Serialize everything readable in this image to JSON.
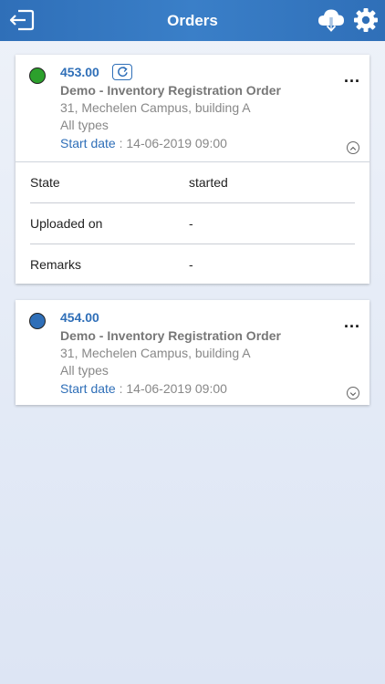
{
  "header": {
    "title": "Orders",
    "back_icon": "logout-arrow-icon",
    "download_icon": "cloud-download-icon",
    "settings_icon": "gear-icon",
    "color": "#2f6fb8"
  },
  "orders": [
    {
      "number": "453.00",
      "status_color": "#2ca02c",
      "name": "Demo - Inventory Registration Order",
      "address": "31, Mechelen Campus, building A",
      "types": "All types",
      "start_label": "Start date",
      "start_sep": " : ",
      "start_value": "14-06-2019 09:00",
      "more": "...",
      "expanded": true,
      "details": [
        {
          "label": "State",
          "value": "started"
        },
        {
          "label": "Uploaded on",
          "value": "-"
        },
        {
          "label": "Remarks",
          "value": "-"
        }
      ]
    },
    {
      "number": "454.00",
      "status_color": "#2f6fb8",
      "name": "Demo - Inventory Registration Order",
      "address": "31, Mechelen Campus, building A",
      "types": "All types",
      "start_label": "Start date",
      "start_sep": " : ",
      "start_value": "14-06-2019 09:00",
      "more": "...",
      "expanded": false
    }
  ]
}
